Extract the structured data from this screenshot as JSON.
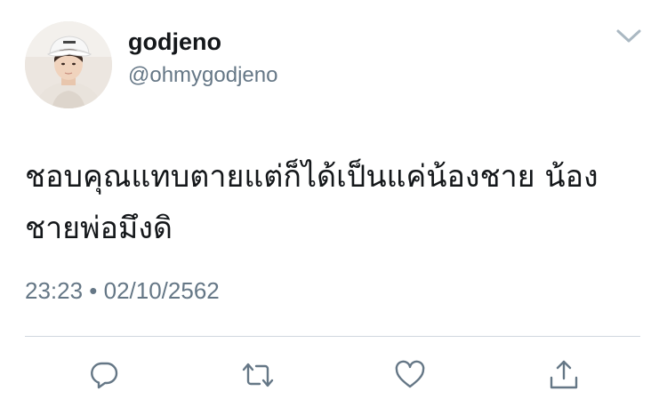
{
  "tweet": {
    "display_name": "godjeno",
    "handle": "@ohmygodjeno",
    "text": "ชอบคุณแทบตายแต่ก็ได้เป็นแค่น้องชาย น้องชายพ่อมึงดิ",
    "timestamp": "23:23 • 02/10/2562"
  },
  "icons": {
    "menu": "chevron-down-icon",
    "reply": "reply-icon",
    "retweet": "retweet-icon",
    "like": "heart-icon",
    "share": "share-icon"
  },
  "colors": {
    "text": "#14171a",
    "secondary": "#657786",
    "icon": "#657786",
    "divider": "#d0d7de"
  }
}
